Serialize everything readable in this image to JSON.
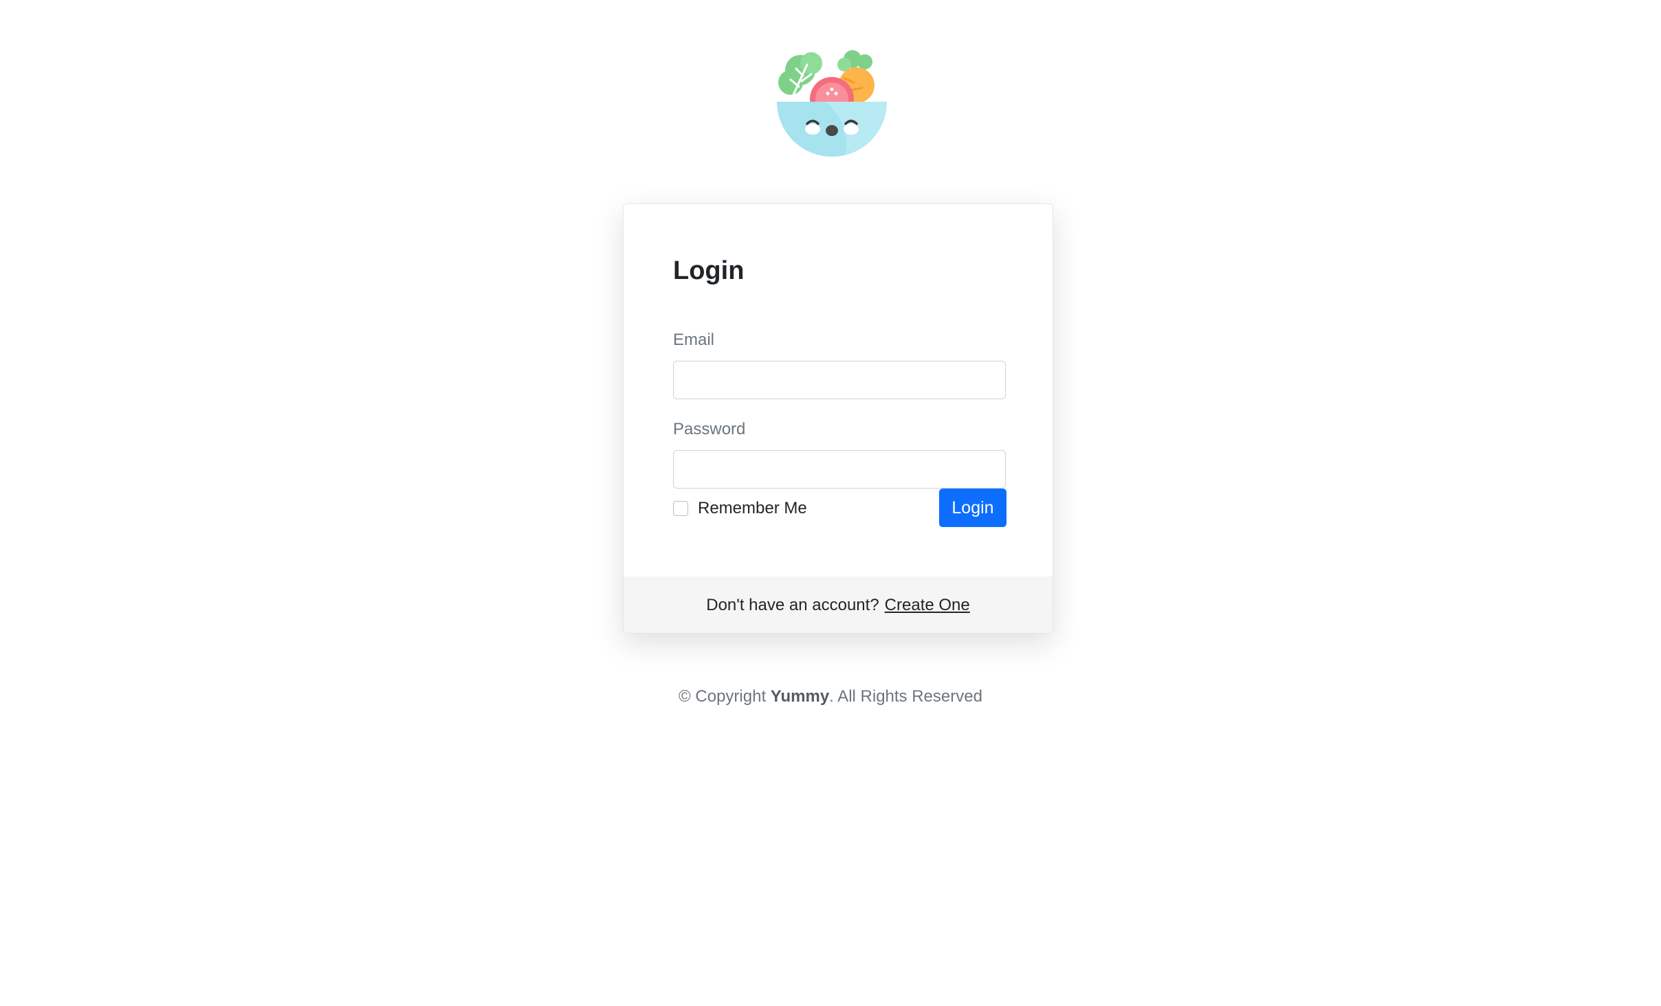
{
  "brand": {
    "logo_icon": "salad-bowl-icon",
    "name": "Yummy"
  },
  "login_card": {
    "title": "Login",
    "email_label": "Email",
    "email_value": "",
    "password_label": "Password",
    "password_value": "",
    "remember_label": "Remember Me",
    "remember_checked": false,
    "submit_label": "Login"
  },
  "card_footer": {
    "prompt": "Don't have an account?",
    "link_label": "Create One"
  },
  "footer": {
    "prefix": "© Copyright",
    "brand": "Yummy",
    "suffix": ". All Rights Reserved"
  },
  "colors": {
    "primary": "#0d6efd",
    "footer_bg": "#f5f5f5",
    "muted_text": "#6c757d"
  }
}
